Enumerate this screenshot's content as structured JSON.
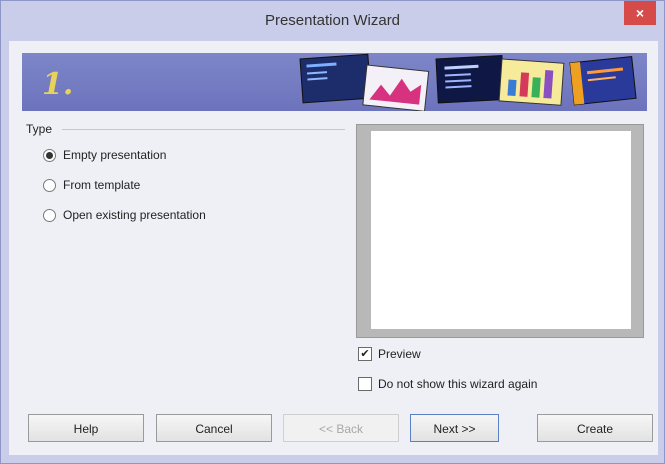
{
  "window": {
    "title": "Presentation Wizard",
    "close_glyph": "×"
  },
  "banner": {
    "step": "1."
  },
  "type_group": {
    "label": "Type",
    "options": [
      {
        "label": "Empty presentation",
        "selected": true
      },
      {
        "label": "From template",
        "selected": false
      },
      {
        "label": "Open existing presentation",
        "selected": false
      }
    ]
  },
  "options": {
    "preview": {
      "label": "Preview",
      "checked": true
    },
    "do_not_show": {
      "label": "Do not show this wizard again",
      "checked": false
    }
  },
  "buttons": {
    "help": "Help",
    "cancel": "Cancel",
    "back": "<< Back",
    "next": "Next >>",
    "create": "Create"
  },
  "colors": {
    "accent": "#6c73bc",
    "close": "#d74a4a",
    "step_number": "#e8d35a"
  }
}
